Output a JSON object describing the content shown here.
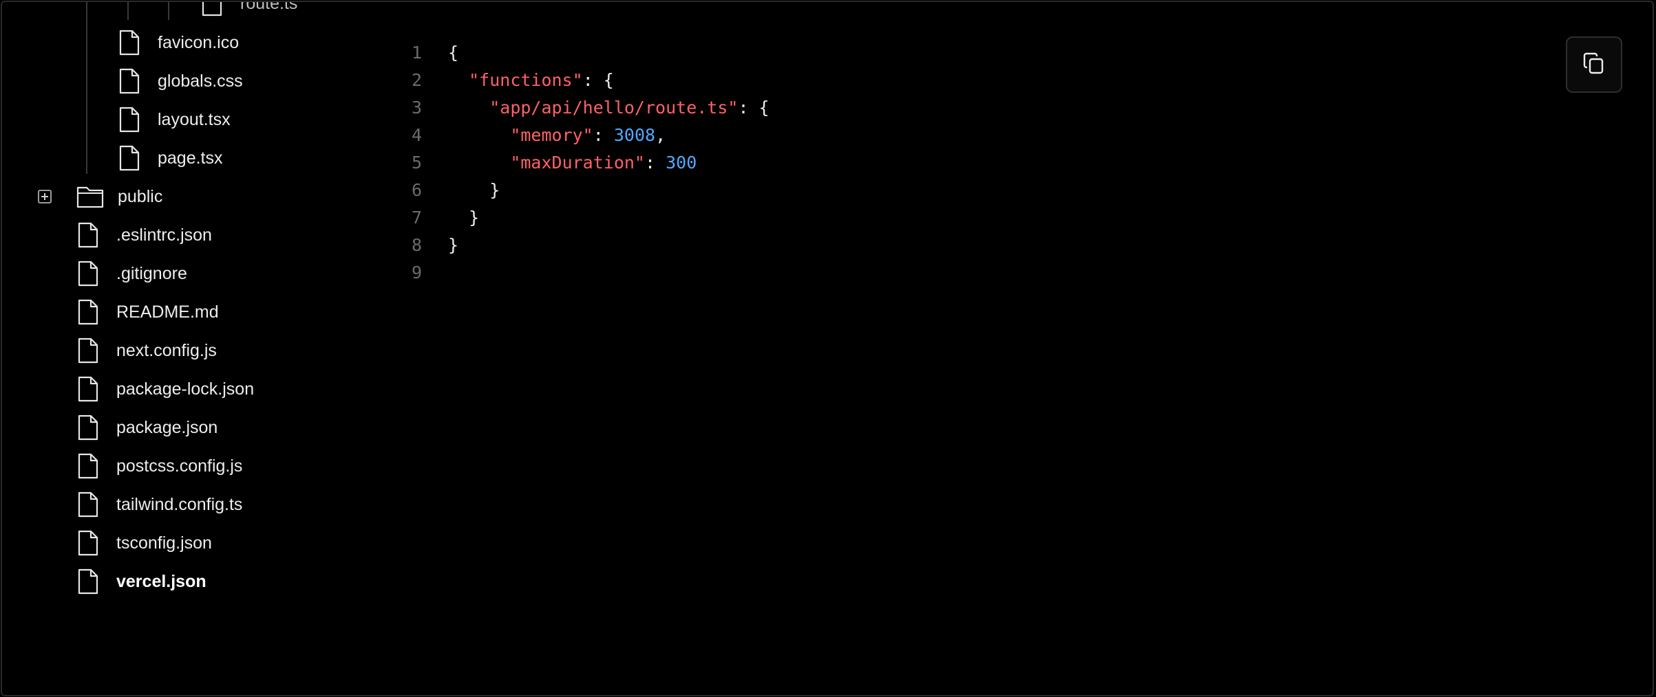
{
  "tree": {
    "partial_top": {
      "label": "route.ts",
      "icon": "file-icon"
    },
    "nested_items": [
      {
        "label": "favicon.ico",
        "icon": "file-icon"
      },
      {
        "label": "globals.css",
        "icon": "file-icon"
      },
      {
        "label": "layout.tsx",
        "icon": "file-icon"
      },
      {
        "label": "page.tsx",
        "icon": "file-icon"
      }
    ],
    "folder": {
      "label": "public",
      "icon": "folder-icon",
      "expanded": false
    },
    "root_files": [
      {
        "label": ".eslintrc.json",
        "icon": "file-icon"
      },
      {
        "label": ".gitignore",
        "icon": "file-icon"
      },
      {
        "label": "README.md",
        "icon": "file-icon"
      },
      {
        "label": "next.config.js",
        "icon": "file-icon"
      },
      {
        "label": "package-lock.json",
        "icon": "file-icon"
      },
      {
        "label": "package.json",
        "icon": "file-icon"
      },
      {
        "label": "postcss.config.js",
        "icon": "file-icon"
      },
      {
        "label": "tailwind.config.ts",
        "icon": "file-icon"
      },
      {
        "label": "tsconfig.json",
        "icon": "file-icon"
      },
      {
        "label": "vercel.json",
        "icon": "file-icon",
        "active": true
      }
    ]
  },
  "code": {
    "lines": [
      {
        "n": "1",
        "tokens": [
          {
            "t": "{",
            "k": "punc"
          }
        ]
      },
      {
        "n": "2",
        "tokens": [
          {
            "t": "  ",
            "k": "punc"
          },
          {
            "t": "\"functions\"",
            "k": "key"
          },
          {
            "t": ": {",
            "k": "punc"
          }
        ]
      },
      {
        "n": "3",
        "tokens": [
          {
            "t": "    ",
            "k": "punc"
          },
          {
            "t": "\"app/api/hello/route.ts\"",
            "k": "key"
          },
          {
            "t": ": {",
            "k": "punc"
          }
        ]
      },
      {
        "n": "4",
        "tokens": [
          {
            "t": "      ",
            "k": "punc"
          },
          {
            "t": "\"memory\"",
            "k": "key"
          },
          {
            "t": ": ",
            "k": "punc"
          },
          {
            "t": "3008",
            "k": "num"
          },
          {
            "t": ",",
            "k": "punc"
          }
        ]
      },
      {
        "n": "5",
        "tokens": [
          {
            "t": "      ",
            "k": "punc"
          },
          {
            "t": "\"maxDuration\"",
            "k": "key"
          },
          {
            "t": ": ",
            "k": "punc"
          },
          {
            "t": "300",
            "k": "num"
          }
        ]
      },
      {
        "n": "6",
        "tokens": [
          {
            "t": "    }",
            "k": "punc"
          }
        ]
      },
      {
        "n": "7",
        "tokens": [
          {
            "t": "  }",
            "k": "punc"
          }
        ]
      },
      {
        "n": "8",
        "tokens": [
          {
            "t": "}",
            "k": "punc"
          }
        ]
      },
      {
        "n": "9",
        "tokens": []
      }
    ]
  },
  "copy_button": {
    "icon": "copy-icon"
  },
  "colors": {
    "background": "#000000",
    "key": "#ff6166",
    "number": "#52a8ff",
    "text": "#ededed",
    "line_number": "#6b6b6b"
  }
}
